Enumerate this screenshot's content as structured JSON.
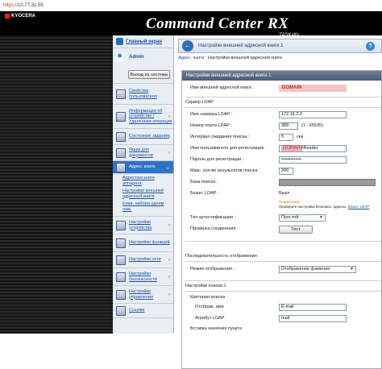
{
  "browser": {
    "protocol": "https://",
    "host": "10.77.31.55"
  },
  "header": {
    "brand": "KYOCERA",
    "product": "Command Center RX",
    "taskalfa": "TASKalfa"
  },
  "nav": {
    "home": "Главный экран",
    "user": "Admin",
    "logout": "Выход из системы",
    "items": [
      {
        "label": "Свойства пользователя"
      },
      {
        "label": "Информация об устройстве / Удаленная операция"
      },
      {
        "label": "Состояние задания"
      },
      {
        "label": "Ящик для документов"
      },
      {
        "label": "Адрес. книга"
      },
      {
        "label": "Настройки устройства"
      },
      {
        "label": "Настройки функций"
      },
      {
        "label": "Настройки сети"
      },
      {
        "label": "Настройки безопасности"
      },
      {
        "label": "Настройки управления"
      },
      {
        "label": "Ссылки"
      }
    ],
    "sub": [
      "Адресная книга аппарата",
      "Настройки внешней адресной книги",
      "Клав. набора одним наж."
    ]
  },
  "main": {
    "title": "Настройки внешней адресной книги 1",
    "breadcrumb_root": "Адрес. книга",
    "breadcrumb_sep": " : ",
    "breadcrumb_current": "Настройки внешней адресной книги",
    "panel_title": "Настройки внешней адресной книги 1",
    "name_label": "Имя внешней адресной книги :",
    "name_value": "DOMAIN",
    "ldap_section": "Сервер LDAP",
    "server_label": "Имя сервера LDAP :",
    "server_value": "172.16.2.2",
    "port_label": "Номер порта LDAP :",
    "port_value": "389",
    "port_range": "(1 - 65535)",
    "timeout_label": "Интервал ожидания поиска :",
    "timeout_value": "5",
    "timeout_unit": "сек.",
    "user_label": "Имя пользователя для регистрации :",
    "user_domain": "DOMAIN",
    "user_value": "\\Reader",
    "pass_label": "Пароль для регистрации :",
    "pass_value": "•••••••••••••",
    "max_label": "Макс. кол-во результатов поиска :",
    "max_value": "200",
    "base_label": "База поиска :",
    "sec_label": "Безоп. LDAP :",
    "sec_value": "Выкл",
    "note_1": "Примечание",
    "note_2": "Проверьте настройки безопасн. адресы.",
    "note_3": "Безоп. LDAP",
    "auth_label": "Тип аутентификации :",
    "auth_value": "Простой",
    "test_label": "Проверка соединения :",
    "test_button": "Тест",
    "display_section": "Последовательность отображения",
    "display_label": "Режим отображения :",
    "display_value": "Отображение фамилии",
    "search_section": "Настройки поиска 1",
    "criteria": "Критерии поиска",
    "disp_name_label": "Отображ. имя",
    "disp_name_value": "E-mail",
    "ldap_attr_label": "Атрибут LDAP",
    "ldap_attr_value": "mail",
    "last_label": "Вставка значения пункта"
  }
}
